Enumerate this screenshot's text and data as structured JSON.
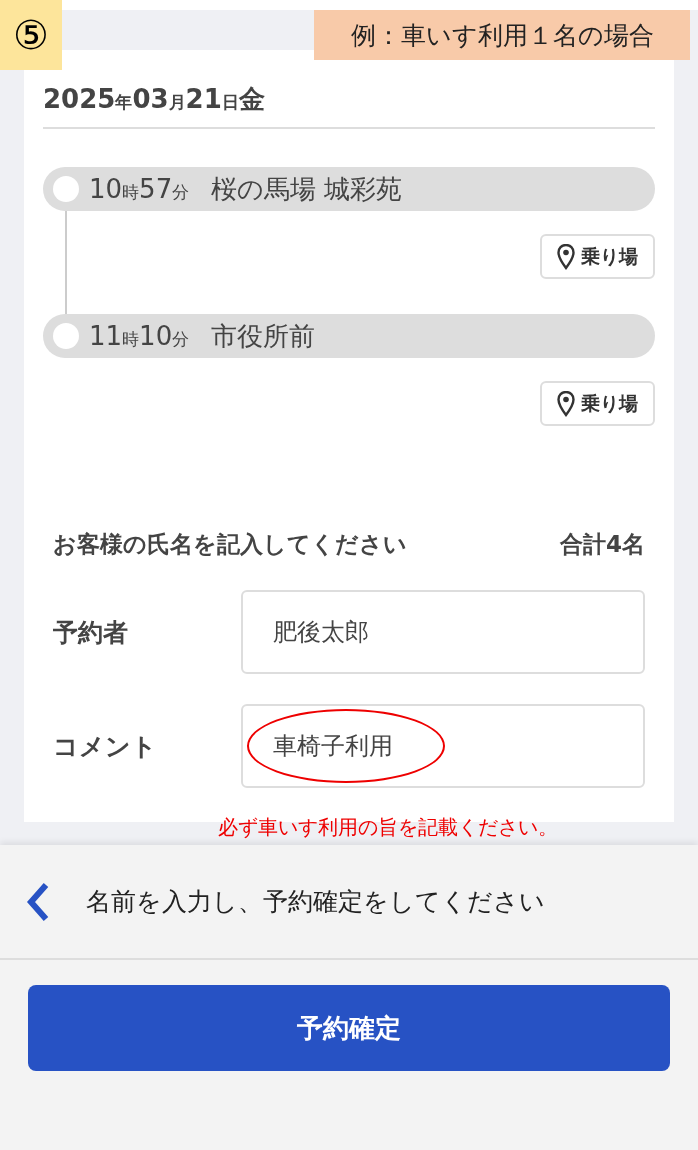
{
  "step_badge": "⑤",
  "example_note": "例：車いす利用１名の場合",
  "date": [
    {
      "text": "2025",
      "kind": "num"
    },
    {
      "text": "年",
      "kind": "unit"
    },
    {
      "text": "03",
      "kind": "num"
    },
    {
      "text": "月",
      "kind": "unit"
    },
    {
      "text": "21",
      "kind": "num"
    },
    {
      "text": "日",
      "kind": "unit"
    },
    {
      "text": "金",
      "kind": "num"
    }
  ],
  "stops": [
    {
      "time": [
        {
          "text": "10",
          "kind": "num"
        },
        {
          "text": "時",
          "kind": "unit"
        },
        {
          "text": "57",
          "kind": "num"
        },
        {
          "text": "分",
          "kind": "unit"
        }
      ],
      "name": "桜の馬場 城彩苑",
      "platform_button": "乗り場"
    },
    {
      "time": [
        {
          "text": "11",
          "kind": "num"
        },
        {
          "text": "時",
          "kind": "unit"
        },
        {
          "text": "10",
          "kind": "num"
        },
        {
          "text": "分",
          "kind": "unit"
        }
      ],
      "name": "市役所前",
      "platform_button": "乗り場"
    }
  ],
  "passengers": {
    "heading": "お客様の氏名を記入してください",
    "total": "合計4名",
    "fields": [
      {
        "label": "予約者",
        "value": "肥後太郎",
        "circled": false
      },
      {
        "label": "コメント",
        "value": "車椅子利用",
        "circled": true
      }
    ]
  },
  "comment_note": "必ず車いす利用の旨を記載ください。",
  "footer": {
    "message": "名前を入力し、予約確定をしてください",
    "confirm_button": "予約確定"
  }
}
